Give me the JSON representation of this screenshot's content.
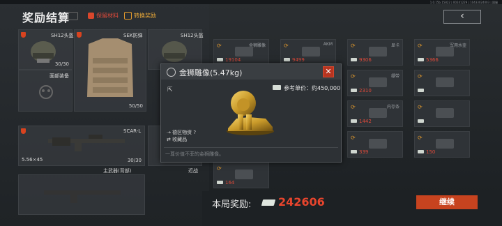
{
  "window": {
    "version_text": "1.0.15b.15822 | 00241229 | 10433024003 | 国服"
  },
  "header": {
    "title": "奖励结算",
    "option_1": "保留材料",
    "option_2": "转换奖励",
    "back_icon": "chevron-left-icon"
  },
  "loadout": {
    "helmet_1": {
      "name": "SH12头盔",
      "durability": "30/30"
    },
    "armor": {
      "name": "SEK防弹",
      "durability": "50/50"
    },
    "helmet_2": {
      "name": "SH12头盔"
    },
    "mask": {
      "name": "面部装备"
    },
    "weapon": {
      "name": "SCAR-L",
      "ammo": "5.56×45",
      "durability": "30/30",
      "slot": "主武器(背部)"
    },
    "melee": {
      "name": "近战"
    }
  },
  "grid": {
    "cells": [
      {
        "name": "金狮雕像",
        "value": "19104"
      },
      {
        "name": "AKM",
        "value": "9499"
      },
      {
        "name": "显卡",
        "value": "9306"
      },
      {
        "name": "军用水壶",
        "value": "5366"
      },
      {
        "name": "",
        "value": ""
      },
      {
        "name": "防弹衣",
        "value": "2648"
      },
      {
        "name": "绷带",
        "value": "2310"
      },
      {
        "name": "",
        "value": ""
      },
      {
        "name": "内存条",
        "value": "1442"
      },
      {
        "name": "",
        "value": ""
      },
      {
        "name": "内存条",
        "value": "1442"
      },
      {
        "name": "",
        "value": ""
      },
      {
        "name": "7.62×39",
        "value": "1442"
      },
      {
        "name": "鲜花",
        "value": "453"
      },
      {
        "name": "",
        "value": "339"
      },
      {
        "name": "",
        "value": "150"
      },
      {
        "name": "",
        "value": "164"
      }
    ]
  },
  "popup": {
    "title": "金狮雕像(5.47kg)",
    "price_label": "参考单价：约450,000",
    "tag_1": "德区物资",
    "tag_2": "收藏品",
    "desc": "一尊价值不菲的金狮雕像。"
  },
  "footer": {
    "reward_label": "本局奖励:",
    "reward_value": "242606",
    "continue_label": "继续"
  }
}
